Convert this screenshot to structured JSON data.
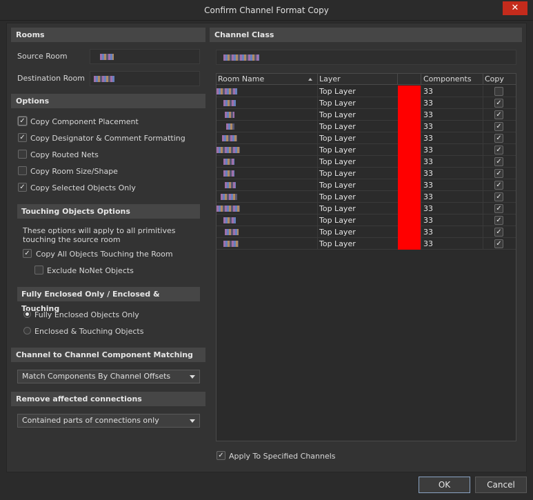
{
  "window": {
    "title": "Confirm Channel Format Copy",
    "close": "✕"
  },
  "rooms": {
    "header": "Rooms",
    "source_label": "Source Room",
    "destination_label": "Destination Room"
  },
  "options": {
    "header": "Options",
    "copy_component_placement": "Copy Component Placement",
    "copy_designator": "Copy Designator & Comment Formatting",
    "copy_routed_nets": "Copy Routed Nets",
    "copy_room_size": "Copy Room Size/Shape",
    "copy_selected_only": "Copy Selected Objects Only"
  },
  "touching": {
    "header": "Touching Objects Options",
    "desc_line1": "These options will apply to all primitives",
    "desc_line2": "touching the source room",
    "copy_all_touching": "Copy All Objects Touching the Room",
    "exclude_nonet": "Exclude NoNet Objects"
  },
  "enclosed": {
    "header": "Fully Enclosed Only / Enclosed & Touching",
    "fully": "Fully Enclosed Objects Only",
    "enclosed_touching": "Enclosed & Touching Objects"
  },
  "matching": {
    "header": "Channel to Channel Component Matching",
    "selected": "Match Components By Channel Offsets"
  },
  "remove": {
    "header": "Remove affected connections",
    "selected": "Contained parts of connections only"
  },
  "channel_class": {
    "header": "Channel Class"
  },
  "table": {
    "columns": [
      "Room Name",
      "Layer",
      "",
      "Components",
      "Copy"
    ],
    "rows": [
      {
        "layer": "Top Layer",
        "components": "33",
        "copy": false
      },
      {
        "layer": "Top Layer",
        "components": "33",
        "copy": true
      },
      {
        "layer": "Top Layer",
        "components": "33",
        "copy": true
      },
      {
        "layer": "Top Layer",
        "components": "33",
        "copy": true
      },
      {
        "layer": "Top Layer",
        "components": "33",
        "copy": true
      },
      {
        "layer": "Top Layer",
        "components": "33",
        "copy": true
      },
      {
        "layer": "Top Layer",
        "components": "33",
        "copy": true
      },
      {
        "layer": "Top Layer",
        "components": "33",
        "copy": true
      },
      {
        "layer": "Top Layer",
        "components": "33",
        "copy": true
      },
      {
        "layer": "Top Layer",
        "components": "33",
        "copy": true
      },
      {
        "layer": "Top Layer",
        "components": "33",
        "copy": true
      },
      {
        "layer": "Top Layer",
        "components": "33",
        "copy": true
      },
      {
        "layer": "Top Layer",
        "components": "33",
        "copy": true
      },
      {
        "layer": "Top Layer",
        "components": "33",
        "copy": true
      }
    ]
  },
  "apply_specified": "Apply To Specified Channels",
  "buttons": {
    "ok": "OK",
    "cancel": "Cancel"
  },
  "colors": {
    "accent": "#ff0000",
    "close": "#c42b1c"
  }
}
